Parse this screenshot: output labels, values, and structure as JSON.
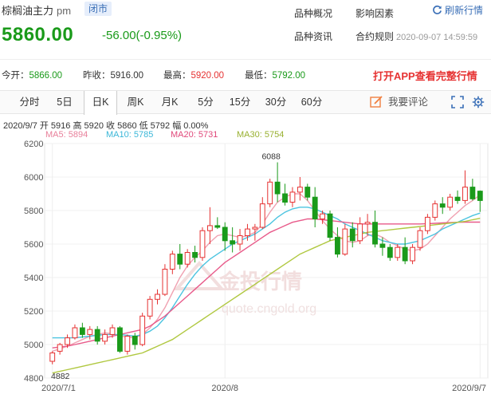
{
  "header": {
    "name": "棕榈油主力",
    "session": "pm",
    "status": "闭市",
    "price": "5860.00",
    "change": "-56.00(-0.95%)",
    "menu": [
      "品种概况",
      "影响因素",
      "品种资讯",
      "合约规则"
    ],
    "refresh_label": "刷新行情",
    "timestamp": "2020-09-07 14:59:59"
  },
  "stats": {
    "open_label": "今开：",
    "open": "5866.00",
    "prev_label": "昨收：",
    "prev": "5916.00",
    "high_label": "最高：",
    "high": "5920.00",
    "low_label": "最低：",
    "low": "5792.00",
    "app_cta": "打开APP查看完整行情"
  },
  "tabs": [
    "分时",
    "5日",
    "日K",
    "周K",
    "月K",
    "5分",
    "15分",
    "30分",
    "60分"
  ],
  "active_tab": "日K",
  "comment_label": "我要评论",
  "ohlc_line": "2020/9/7  开 5916  高 5920  收 5860  低 5792  幅 0.00%",
  "ma_labels": {
    "ma5": "MA5: 5894",
    "ma10": "MA10: 5785",
    "ma20": "MA20: 5731",
    "ma30": "MA30: 5754"
  },
  "colors": {
    "up": "#e63232",
    "down": "#1a9a1a",
    "ma5": "#f0a0b0",
    "ma10": "#4cc4e0",
    "ma20": "#e85a8a",
    "ma30": "#b0c840",
    "accent": "#3a6fb7"
  },
  "watermark": {
    "brand": "金投行情",
    "url": "quote.cngold.org"
  },
  "chart_data": {
    "type": "candlestick",
    "x_tick_labels": [
      "2020/7/1",
      "2020/8",
      "2020/9/7"
    ],
    "y_ticks": [
      4800,
      5000,
      5200,
      5400,
      5600,
      5800,
      6000,
      6200
    ],
    "ylim": [
      4800,
      6200
    ],
    "annotations": {
      "max": "6088",
      "min": "4882"
    },
    "candles": [
      {
        "o": 4900,
        "h": 4960,
        "l": 4882,
        "c": 4950
      },
      {
        "o": 4960,
        "h": 5010,
        "l": 4940,
        "c": 5000
      },
      {
        "o": 5000,
        "h": 5060,
        "l": 4980,
        "c": 5040
      },
      {
        "o": 5040,
        "h": 5120,
        "l": 5030,
        "c": 5100
      },
      {
        "o": 5100,
        "h": 5130,
        "l": 5040,
        "c": 5060
      },
      {
        "o": 5060,
        "h": 5110,
        "l": 5030,
        "c": 5090
      },
      {
        "o": 5090,
        "h": 5110,
        "l": 5000,
        "c": 5020
      },
      {
        "o": 5020,
        "h": 5090,
        "l": 5000,
        "c": 5060
      },
      {
        "o": 5060,
        "h": 5120,
        "l": 5040,
        "c": 5100
      },
      {
        "o": 5100,
        "h": 5110,
        "l": 4950,
        "c": 4960
      },
      {
        "o": 4960,
        "h": 5060,
        "l": 4940,
        "c": 5050
      },
      {
        "o": 5050,
        "h": 5070,
        "l": 4970,
        "c": 5000
      },
      {
        "o": 5000,
        "h": 5190,
        "l": 4990,
        "c": 5170
      },
      {
        "o": 5170,
        "h": 5290,
        "l": 5150,
        "c": 5270
      },
      {
        "o": 5270,
        "h": 5330,
        "l": 5240,
        "c": 5300
      },
      {
        "o": 5300,
        "h": 5480,
        "l": 5290,
        "c": 5450
      },
      {
        "o": 5450,
        "h": 5560,
        "l": 5420,
        "c": 5540
      },
      {
        "o": 5540,
        "h": 5600,
        "l": 5450,
        "c": 5480
      },
      {
        "o": 5480,
        "h": 5570,
        "l": 5460,
        "c": 5550
      },
      {
        "o": 5550,
        "h": 5590,
        "l": 5490,
        "c": 5520
      },
      {
        "o": 5520,
        "h": 5700,
        "l": 5500,
        "c": 5680
      },
      {
        "o": 5680,
        "h": 5820,
        "l": 5600,
        "c": 5710
      },
      {
        "o": 5710,
        "h": 5760,
        "l": 5690,
        "c": 5700
      },
      {
        "o": 5700,
        "h": 5730,
        "l": 5560,
        "c": 5620
      },
      {
        "o": 5620,
        "h": 5700,
        "l": 5550,
        "c": 5600
      },
      {
        "o": 5600,
        "h": 5690,
        "l": 5560,
        "c": 5650
      },
      {
        "o": 5650,
        "h": 5720,
        "l": 5620,
        "c": 5690
      },
      {
        "o": 5690,
        "h": 5720,
        "l": 5620,
        "c": 5700
      },
      {
        "o": 5700,
        "h": 5880,
        "l": 5690,
        "c": 5840
      },
      {
        "o": 5840,
        "h": 5990,
        "l": 5820,
        "c": 5970
      },
      {
        "o": 5970,
        "h": 6088,
        "l": 5850,
        "c": 5900
      },
      {
        "o": 5900,
        "h": 5960,
        "l": 5830,
        "c": 5850
      },
      {
        "o": 5850,
        "h": 5940,
        "l": 5820,
        "c": 5910
      },
      {
        "o": 5910,
        "h": 6000,
        "l": 5860,
        "c": 5940
      },
      {
        "o": 5940,
        "h": 5960,
        "l": 5860,
        "c": 5880
      },
      {
        "o": 5880,
        "h": 5940,
        "l": 5700,
        "c": 5750
      },
      {
        "o": 5750,
        "h": 5800,
        "l": 5720,
        "c": 5780
      },
      {
        "o": 5780,
        "h": 5800,
        "l": 5620,
        "c": 5640
      },
      {
        "o": 5640,
        "h": 5700,
        "l": 5520,
        "c": 5540
      },
      {
        "o": 5540,
        "h": 5720,
        "l": 5530,
        "c": 5690
      },
      {
        "o": 5690,
        "h": 5730,
        "l": 5580,
        "c": 5620
      },
      {
        "o": 5620,
        "h": 5760,
        "l": 5600,
        "c": 5720
      },
      {
        "o": 5720,
        "h": 5780,
        "l": 5650,
        "c": 5730
      },
      {
        "o": 5730,
        "h": 5800,
        "l": 5580,
        "c": 5600
      },
      {
        "o": 5600,
        "h": 5640,
        "l": 5530,
        "c": 5580
      },
      {
        "o": 5580,
        "h": 5600,
        "l": 5500,
        "c": 5520
      },
      {
        "o": 5520,
        "h": 5600,
        "l": 5500,
        "c": 5580
      },
      {
        "o": 5580,
        "h": 5640,
        "l": 5480,
        "c": 5500
      },
      {
        "o": 5500,
        "h": 5600,
        "l": 5480,
        "c": 5580
      },
      {
        "o": 5580,
        "h": 5700,
        "l": 5560,
        "c": 5680
      },
      {
        "o": 5680,
        "h": 5780,
        "l": 5660,
        "c": 5760
      },
      {
        "o": 5760,
        "h": 5860,
        "l": 5740,
        "c": 5840
      },
      {
        "o": 5840,
        "h": 5880,
        "l": 5780,
        "c": 5820
      },
      {
        "o": 5820,
        "h": 5900,
        "l": 5800,
        "c": 5880
      },
      {
        "o": 5880,
        "h": 5920,
        "l": 5840,
        "c": 5860
      },
      {
        "o": 5860,
        "h": 6040,
        "l": 5840,
        "c": 5940
      },
      {
        "o": 5940,
        "h": 5990,
        "l": 5860,
        "c": 5870
      },
      {
        "o": 5916,
        "h": 5920,
        "l": 5792,
        "c": 5860
      }
    ],
    "series": [
      {
        "name": "MA5",
        "values": [
          4960,
          4975,
          4990,
          5010,
          5030,
          5050,
          5060,
          5070,
          5065,
          5050,
          5045,
          5040,
          5060,
          5100,
          5150,
          5220,
          5310,
          5400,
          5470,
          5520,
          5560,
          5610,
          5650,
          5660,
          5650,
          5640,
          5650,
          5670,
          5720,
          5790,
          5850,
          5880,
          5900,
          5900,
          5860,
          5800,
          5740,
          5690,
          5650,
          5620,
          5610,
          5620,
          5650,
          5660,
          5640,
          5610,
          5590,
          5570,
          5560,
          5570,
          5600,
          5650,
          5700,
          5750,
          5790,
          5830,
          5860,
          5894
        ]
      },
      {
        "name": "MA10",
        "values": [
          5040,
          5040,
          5040,
          5040,
          5045,
          5050,
          5055,
          5060,
          5060,
          5060,
          5055,
          5050,
          5060,
          5080,
          5110,
          5160,
          5220,
          5290,
          5360,
          5420,
          5470,
          5510,
          5540,
          5570,
          5600,
          5620,
          5640,
          5660,
          5690,
          5720,
          5760,
          5790,
          5810,
          5820,
          5820,
          5810,
          5790,
          5770,
          5750,
          5720,
          5700,
          5680,
          5660,
          5640,
          5620,
          5610,
          5600,
          5600,
          5610,
          5620,
          5640,
          5660,
          5690,
          5710,
          5730,
          5750,
          5770,
          5785
        ]
      },
      {
        "name": "MA20",
        "values": [
          4980,
          4985,
          4990,
          5000,
          5010,
          5020,
          5030,
          5040,
          5050,
          5060,
          5070,
          5080,
          5090,
          5110,
          5140,
          5170,
          5210,
          5250,
          5290,
          5330,
          5370,
          5410,
          5450,
          5490,
          5520,
          5550,
          5580,
          5610,
          5640,
          5670,
          5690,
          5710,
          5730,
          5740,
          5750,
          5750,
          5745,
          5740,
          5735,
          5730,
          5725,
          5720,
          5720,
          5720,
          5720,
          5720,
          5720,
          5720,
          5720,
          5720,
          5722,
          5724,
          5726,
          5728,
          5730,
          5731,
          5731,
          5731
        ]
      },
      {
        "name": "MA30",
        "values": [
          4830,
          4840,
          4850,
          4860,
          4870,
          4880,
          4890,
          4900,
          4910,
          4920,
          4930,
          4940,
          4950,
          4970,
          4990,
          5010,
          5030,
          5060,
          5090,
          5120,
          5150,
          5180,
          5210,
          5240,
          5270,
          5300,
          5330,
          5360,
          5390,
          5420,
          5450,
          5480,
          5510,
          5540,
          5560,
          5580,
          5600,
          5620,
          5630,
          5640,
          5650,
          5660,
          5670,
          5675,
          5680,
          5685,
          5690,
          5695,
          5700,
          5705,
          5710,
          5715,
          5720,
          5725,
          5730,
          5735,
          5745,
          5754
        ]
      }
    ]
  }
}
